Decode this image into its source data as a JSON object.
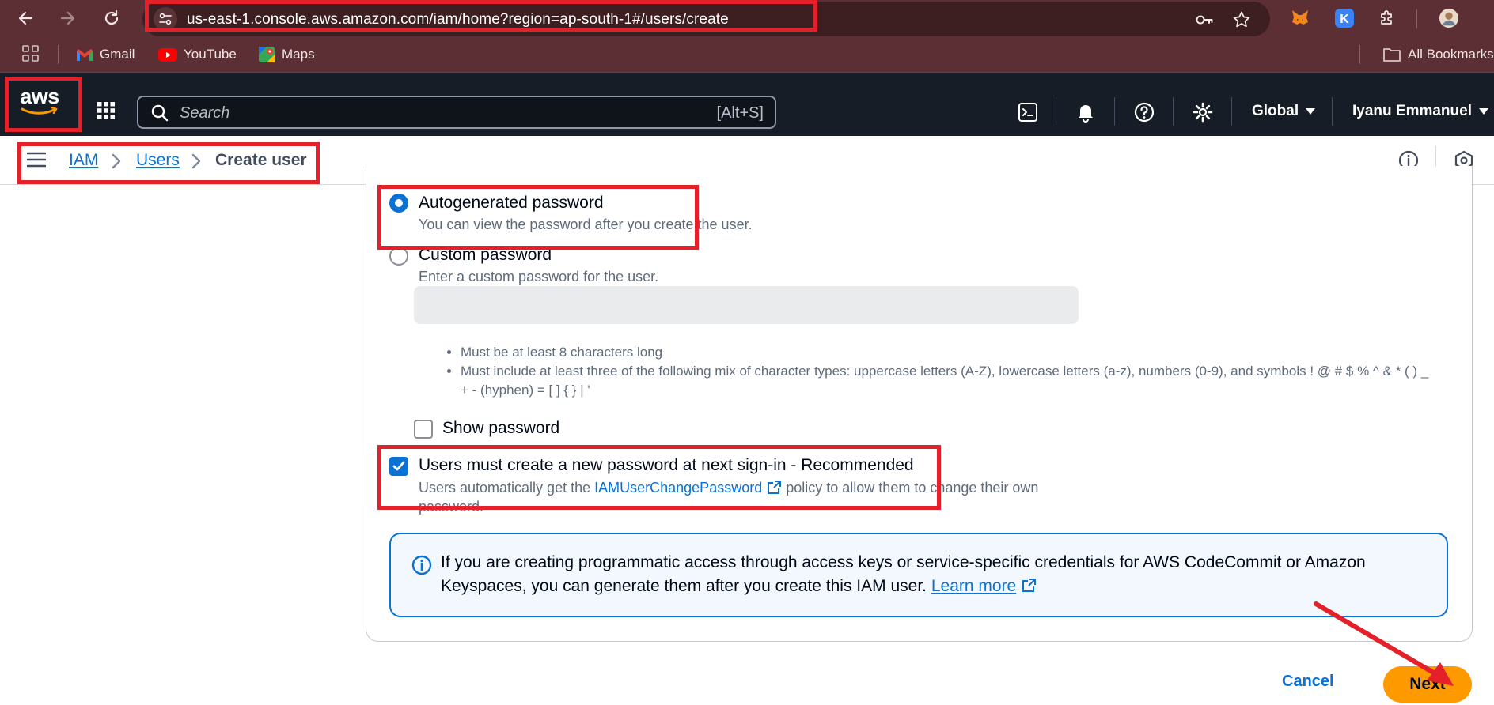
{
  "browser": {
    "url": "us-east-1.console.aws.amazon.com/iam/home?region=ap-south-1#/users/create",
    "bookmarks": [
      "Gmail",
      "YouTube",
      "Maps"
    ],
    "all_bookmarks_label": "All Bookmarks"
  },
  "aws_header": {
    "logo_text": "aws",
    "search_placeholder": "Search",
    "search_shortcut": "[Alt+S]",
    "region_label": "Global",
    "account_label": "Iyanu Emmanuel"
  },
  "breadcrumb": {
    "items": [
      "IAM",
      "Users",
      "Create user"
    ]
  },
  "password_options": {
    "autogenerated": {
      "label": "Autogenerated password",
      "description": "You can view the password after you create the user.",
      "selected": true
    },
    "custom": {
      "label": "Custom password",
      "description": "Enter a custom password for the user.",
      "selected": false
    },
    "requirements": [
      "Must be at least 8 characters long",
      "Must include at least three of the following mix of character types: uppercase letters (A-Z), lowercase letters (a-z), numbers (0-9), and symbols ! @ # $ % ^ & * ( ) _ + - (hyphen) = [ ] { } | '"
    ],
    "show_password_label": "Show password",
    "reset_required": {
      "label": "Users must create a new password at next sign-in - Recommended",
      "description_prefix": "Users automatically get the",
      "policy_link": "IAMUserChangePassword",
      "description_suffix": "policy to allow them to change their own password.",
      "checked": true
    }
  },
  "info_alert": {
    "text": "If you are creating programmatic access through access keys or service-specific credentials for AWS CodeCommit or Amazon Keyspaces, you can generate them after you create this IAM user.",
    "link_label": "Learn more"
  },
  "actions": {
    "cancel_label": "Cancel",
    "next_label": "Next"
  },
  "colors": {
    "aws_orange": "#ff9900",
    "link_blue": "#0972d3",
    "annotation_red": "#e4202b",
    "browser_chrome": "#5b2f33",
    "console_header": "#161d26"
  }
}
